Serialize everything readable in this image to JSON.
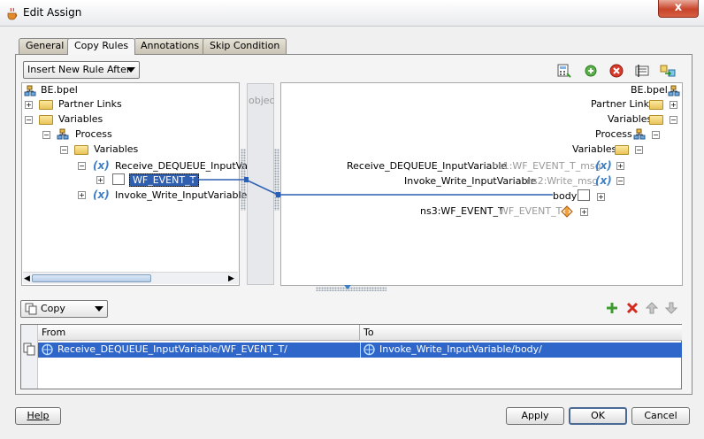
{
  "window": {
    "title": "Edit Assign",
    "close_label": "x"
  },
  "tabs": [
    {
      "label": "General"
    },
    {
      "label": "Copy Rules",
      "active": true
    },
    {
      "label": "Annotations"
    },
    {
      "label": "Skip Condition"
    }
  ],
  "rule_mode": {
    "selected": "Insert New Rule After"
  },
  "source_tree": {
    "root": "BE.bpel",
    "partner_links": "Partner Links",
    "variables": "Variables",
    "process": "Process",
    "process_variables": "Variables",
    "receive_var": "Receive_DEQUEUE_InputVaria",
    "selected_node": "WF_EVENT_T",
    "invoke_var": "Invoke_Write_InputVariable"
  },
  "middle_strip_label": "objec",
  "target_tree": {
    "root": "BE.bpel",
    "partner_links": "Partner Links",
    "variables": "Variables",
    "process": "Process",
    "process_variables": "Variables",
    "receive_var": "Receive_DEQUEUE_InputVariable",
    "receive_type": "ns1:WF_EVENT_T_msg",
    "invoke_var": "Invoke_Write_InputVariable",
    "invoke_type": "ns2:Write_msg",
    "body": "body",
    "ns3_elem": "ns3:WF_EVENT_T",
    "ns3_type": "WF_EVENT_T"
  },
  "operation": {
    "selected": "Copy"
  },
  "rules_table": {
    "headers": {
      "from": "From",
      "to": "To"
    },
    "rows": [
      {
        "from": "Receive_DEQUEUE_InputVariable/WF_EVENT_T/",
        "to": "Invoke_Write_InputVariable/body/"
      }
    ]
  },
  "buttons": {
    "help": "Help",
    "apply": "Apply",
    "ok": "OK",
    "cancel": "Cancel"
  },
  "colors": {
    "selection": "#2f66c9",
    "mapping_line": "#2c5fb3",
    "variable_icon": "#3a7fc8"
  }
}
